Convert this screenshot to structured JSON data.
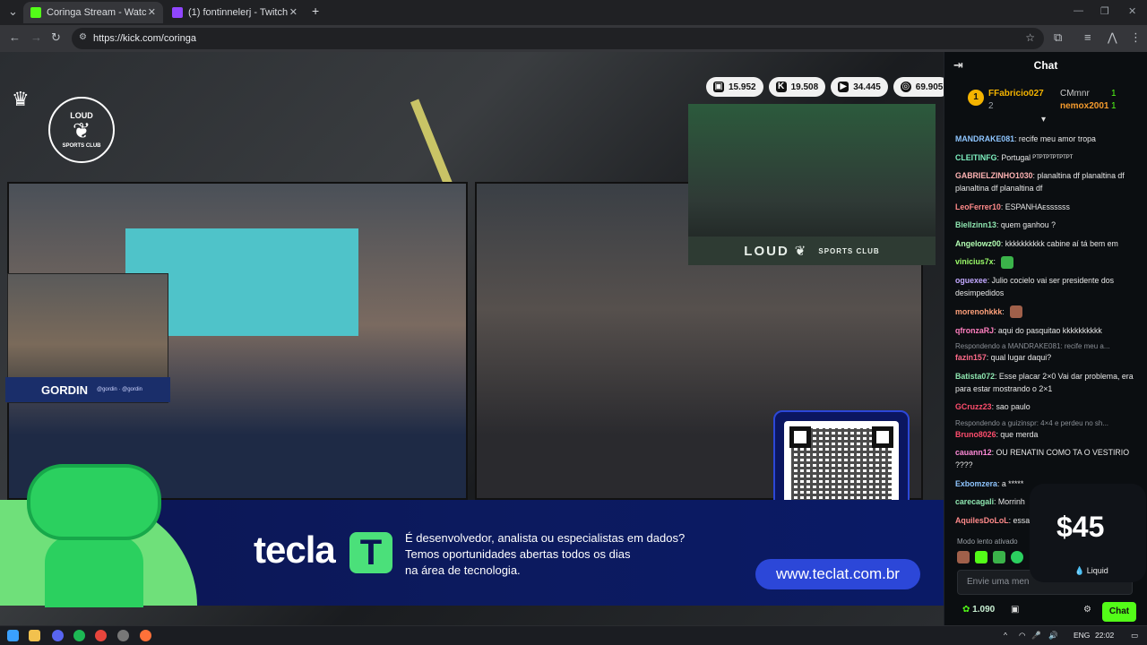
{
  "browser": {
    "tabs": [
      {
        "title": "Coringa Stream - Watch Live on",
        "favicon_color": "#53fc18",
        "active": true
      },
      {
        "title": "(1) fontinnelerj - Twitch",
        "favicon_color": "#9146ff",
        "active": false
      }
    ],
    "url": "https://kick.com/coringa",
    "new_tab": "+"
  },
  "stream": {
    "counters": [
      {
        "icon": "twitch-icon",
        "value": "15.952",
        "color": "#9146ff"
      },
      {
        "icon": "kick-icon",
        "value": "19.508",
        "color": "#111111"
      },
      {
        "icon": "youtube-icon",
        "value": "34.445",
        "color": "#ff0000"
      },
      {
        "icon": "globe-icon",
        "value": "69.905",
        "color": "#111111"
      }
    ],
    "loud_bar": "LOUD",
    "loud_small": "SPORTS CLUB",
    "logo_top": "LOUD",
    "logo_bottom": "SPORTS CLUB",
    "streamer_name": "GORDIN",
    "streamer_sub": "@gordin · @gordin",
    "banner": {
      "logo": "tecla",
      "logo_t": "T",
      "line1": "É desenvolvedor, analista ou especialistas em dados?",
      "line2": "Temos oportunidades abertas todos os dias",
      "line3": "na área de tecnologia.",
      "url": "www.teclat.com.br"
    }
  },
  "chat": {
    "title": "Chat",
    "leaders": [
      {
        "name": "FFabricio027",
        "count": "2",
        "color": "#f5b400"
      },
      {
        "name": "CMmnr",
        "count": "1",
        "color": "#c9c9c9"
      },
      {
        "name": "nemox2001",
        "count": "1",
        "color": "#f59b2d"
      }
    ],
    "messages": [
      {
        "user": "MANDRAKE081",
        "color": "#8ec5ff",
        "text": ": recife meu amor tropa"
      },
      {
        "user": "CLEITINFG",
        "color": "#7ef0c0",
        "text": ": Portugal ᴾᵀᴾᵀᴾᵀᴾᵀᴾᵀᴾᵀ"
      },
      {
        "user": "GABRIELZINHO1030",
        "color": "#ffb3b3",
        "text": ": planaltina df planaltina df planaltina df planaltina df"
      },
      {
        "user": "LeoFerrer10",
        "color": "#ff8a8a",
        "text": ": ESPANHAᴇssssss"
      },
      {
        "user": "Biellzinn13",
        "color": "#8ee6b0",
        "text": ": quem ganhou ?"
      },
      {
        "user": "Angelowz00",
        "color": "#b3ffb3",
        "text": ": kkkkkkkkkk cabine aí tá bem em"
      },
      {
        "user": "vinicius7x",
        "color": "#9cff6a",
        "text": ":"
      },
      {
        "user": "oguexee",
        "color": "#c2a8ff",
        "text": ": Julio cocielo vai ser presidente dos desimpedidos"
      },
      {
        "user": "morenohkkk",
        "color": "#ffa07a",
        "text": ":"
      },
      {
        "user": "qfronzaRJ",
        "color": "#ff7fbf",
        "text": ": aqui do pasquitao kkkkkkkkkk"
      },
      {
        "reply": "Respondendo a MANDRAKE081: recife meu a...",
        "user": "fazin157",
        "color": "#ff6b8a",
        "text": ": qual lugar daqui?"
      },
      {
        "user": "Batista072",
        "color": "#8ee6b0",
        "text": ": Esse placar 2×0 Vai dar problema, era para estar mostrando o 2×1"
      },
      {
        "user": "GCruzz23",
        "color": "#ff4d6d",
        "text": ": sao paulo"
      },
      {
        "reply": "Respondendo a guizinspr: 4×4 e perdeu no sh...",
        "user": "Bruno8026",
        "color": "#ff4d6d",
        "text": ": que merda"
      },
      {
        "user": "cauann12",
        "color": "#ff8ad8",
        "text": ": OU RENATIN COMO TA O VESTIRIO ????"
      },
      {
        "user": "Exbomzera",
        "color": "#8ec5ff",
        "text": ": a *****"
      },
      {
        "user": "carecagali",
        "color": "#8ee6b0",
        "text": ": Morrinh"
      },
      {
        "user": "AquilesDoLoL",
        "color": "#ff8a8a",
        "text": ": essa"
      }
    ],
    "slow_mode": "Modo lento ativado",
    "input_placeholder": "Envie uma men",
    "points": "1.090",
    "send_label": "Chat"
  },
  "liquid": {
    "price": "$45",
    "brand": "Liquid"
  },
  "taskbar": {
    "lang": "ENG",
    "time": "22:02"
  }
}
